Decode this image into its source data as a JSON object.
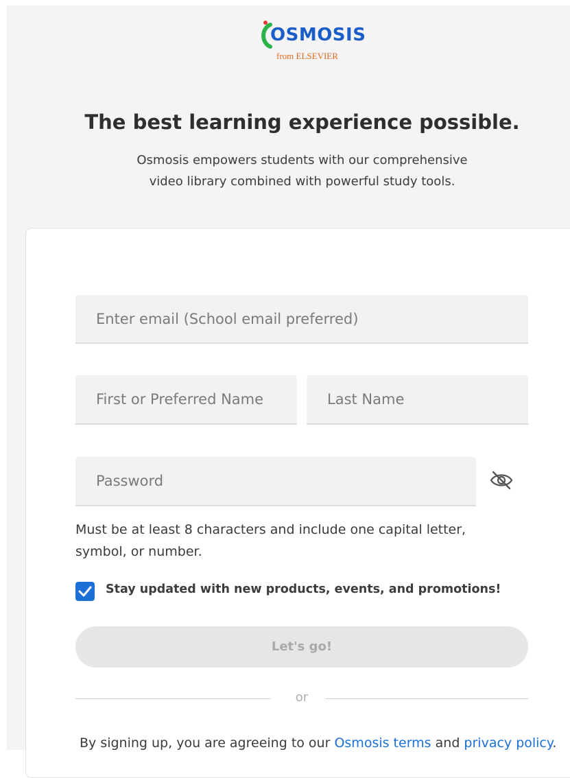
{
  "brand": {
    "name": "OSMOSIS",
    "tagline": "from ELSEVIER",
    "name_color": "#1a5dc8",
    "tagline_color": "#e06a1c"
  },
  "hero": {
    "headline": "The best learning experience possible.",
    "subline_1": "Osmosis empowers students with our comprehensive",
    "subline_2": "video library combined with powerful study tools."
  },
  "form": {
    "email_placeholder": "Enter email (School email preferred)",
    "first_name_placeholder": "First or Preferred Name",
    "last_name_placeholder": "Last Name",
    "password_placeholder": "Password",
    "password_toggle_icon": "eye-off-icon",
    "password_hint_1": "Must be at least 8 characters and include one capital letter,",
    "password_hint_2": "symbol, or number.",
    "updates_checked": true,
    "updates_label": "Stay updated with new products, events, and promotions!",
    "submit_label": "Let's go!",
    "divider_label": "or",
    "accent_color": "#1b6fd6"
  },
  "legal": {
    "prefix": "By signing up, you are agreeing to our ",
    "terms_link": "Osmosis terms",
    "middle": " and ",
    "privacy_link": "privacy policy",
    "suffix": "."
  }
}
